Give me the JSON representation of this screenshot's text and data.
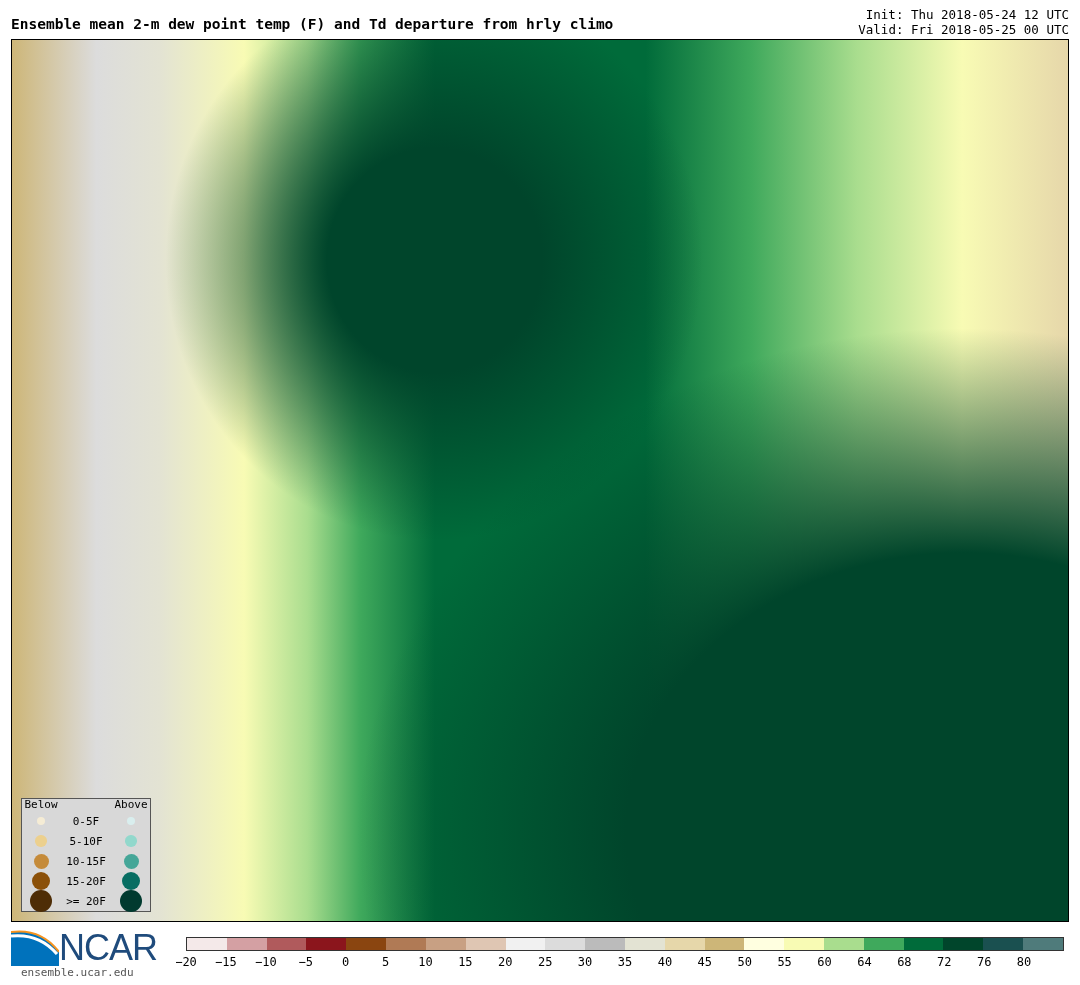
{
  "title": "Ensemble mean 2-m dew point temp (F) and Td departure from hrly climo",
  "init": "Init: Thu 2018-05-24 12 UTC",
  "valid": "Valid: Fri 2018-05-25 00 UTC",
  "legend": {
    "below_header": "Below",
    "above_header": "Above",
    "rows": [
      {
        "label": "0-5F",
        "below": {
          "color": "#f5ecd5"
        },
        "above": {
          "color": "#d9eeee"
        }
      },
      {
        "label": "5-10F",
        "below": {
          "color": "#ecd08e"
        },
        "above": {
          "color": "#92d8cc"
        }
      },
      {
        "label": "10-15F",
        "below": {
          "color": "#c58b3a"
        },
        "above": {
          "color": "#45a698"
        }
      },
      {
        "label": "15-20F",
        "below": {
          "color": "#8b5008"
        },
        "above": {
          "color": "#076d62"
        }
      },
      {
        "label": ">= 20F",
        "below": {
          "color": "#4e2d06"
        },
        "above": {
          "color": "#013a2f"
        }
      }
    ]
  },
  "logo": {
    "text": "NCAR",
    "url": "ensemble.ucar.edu"
  },
  "colorbar": {
    "segments": [
      {
        "color": "#f4e9e9"
      },
      {
        "color": "#d4a0a3"
      },
      {
        "color": "#b05a5c"
      },
      {
        "color": "#8b151c"
      },
      {
        "color": "#8a4510"
      },
      {
        "color": "#b07a55"
      },
      {
        "color": "#c8a083"
      },
      {
        "color": "#dfc6b3"
      },
      {
        "color": "#f1f1f1"
      },
      {
        "color": "#dcdcdc"
      },
      {
        "color": "#bbbbbb"
      },
      {
        "color": "#e3e3d3"
      },
      {
        "color": "#e6d7aa"
      },
      {
        "color": "#cdb678"
      },
      {
        "color": "#ffffe0"
      },
      {
        "color": "#f8fbb4"
      },
      {
        "color": "#a9dd8e"
      },
      {
        "color": "#3fa95c"
      },
      {
        "color": "#006b3a"
      },
      {
        "color": "#00452b"
      },
      {
        "color": "#1a5050"
      },
      {
        "color": "#4f7b7b"
      }
    ],
    "ticks": [
      "−20",
      "−15",
      "−10",
      "−5",
      "0",
      "5",
      "10",
      "15",
      "20",
      "25",
      "30",
      "35",
      "40",
      "45",
      "50",
      "55",
      "60",
      "64",
      "68",
      "72",
      "76",
      "80"
    ]
  }
}
